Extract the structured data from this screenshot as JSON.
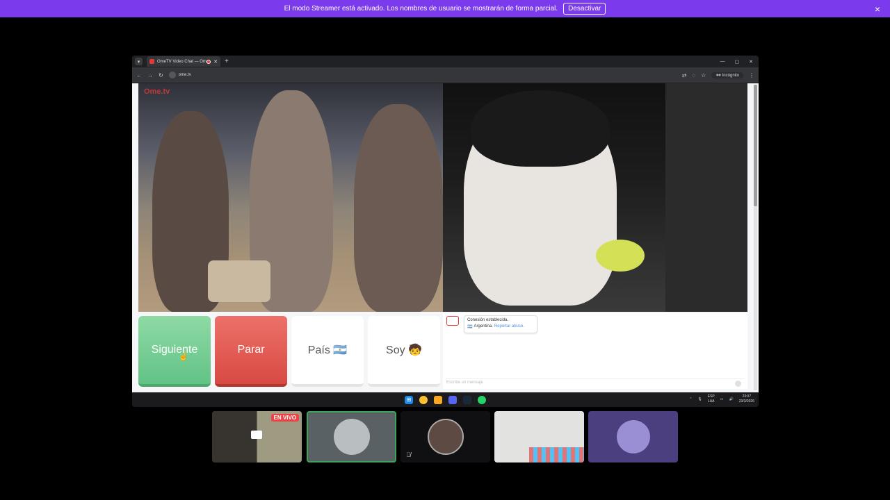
{
  "banner": {
    "message": "El modo Streamer está activado. Los nombres de usuario se mostrarán de forma parcial.",
    "button_label": "Desactivar",
    "close_icon": "×"
  },
  "browser": {
    "tab_title": "OmeTV Video Chat — Om",
    "tab_close": "✕",
    "new_tab": "+",
    "url": "ome.tv",
    "incognito_label": "Incógnito",
    "window_controls": [
      "—",
      "▢",
      "✕"
    ]
  },
  "ome": {
    "logo": "Ome.tv",
    "buttons": {
      "next": "Siguiente",
      "stop": "Parar",
      "country": "País 🇦🇷",
      "me": "Soy 🧒"
    },
    "chat": {
      "status": "Conexión establecida.",
      "country": "Argentina.",
      "report": "Reportar abuso.",
      "input_placeholder": "Escribe un mensaje"
    }
  },
  "taskbar": {
    "lang_top": "ESP",
    "lang_bottom": "LAA",
    "time": "23:07",
    "date": "23/3/2026"
  },
  "participants": {
    "live_badge": "EN VIVO"
  },
  "colors": {
    "banner": "#7c3aed",
    "next_button": "#62c386",
    "stop_button": "#d84a43",
    "speaking_border": "#3ba55c"
  }
}
